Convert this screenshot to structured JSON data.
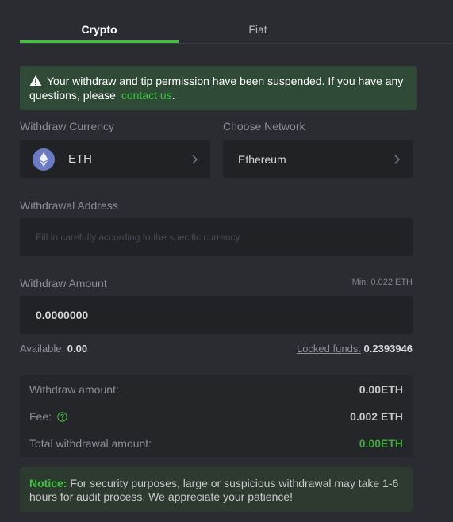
{
  "tabs": [
    {
      "label": "Crypto",
      "active": true
    },
    {
      "label": "Fiat",
      "active": false
    }
  ],
  "alert": {
    "icon": "warning-icon",
    "text": "Your withdraw and tip permission have been suspended. If you have any questions, please",
    "link": "contact us",
    "suffix": "."
  },
  "currency": {
    "label": "Withdraw Currency",
    "value": "ETH",
    "icon": "eth-icon"
  },
  "network": {
    "label": "Choose Network",
    "value": "Ethereum"
  },
  "address": {
    "label": "Withdrawal Address",
    "placeholder": "Fill in carefully according to the specific currency"
  },
  "amount": {
    "label": "Withdraw Amount",
    "min": "Min: 0.022 ETH",
    "value": "0.0000000"
  },
  "balance": {
    "available_label": "Available:",
    "available_value": "0.00",
    "locked_label": "Locked funds:",
    "locked_value": "0.2393946"
  },
  "summary": {
    "withdraw_label": "Withdraw amount:",
    "withdraw_value": "0.00ETH",
    "fee_label": "Fee:",
    "fee_value": "0.002 ETH",
    "total_label": "Total withdrawal amount:",
    "total_value": "0.00ETH"
  },
  "notice": {
    "title": "Notice:",
    "text": "For security purposes, large or suspicious withdrawal may take 1-6 hours for audit process. We appreciate your patience!"
  },
  "colors": {
    "accent": "#3ec43d",
    "background": "#2a2c31",
    "field": "#202226"
  }
}
